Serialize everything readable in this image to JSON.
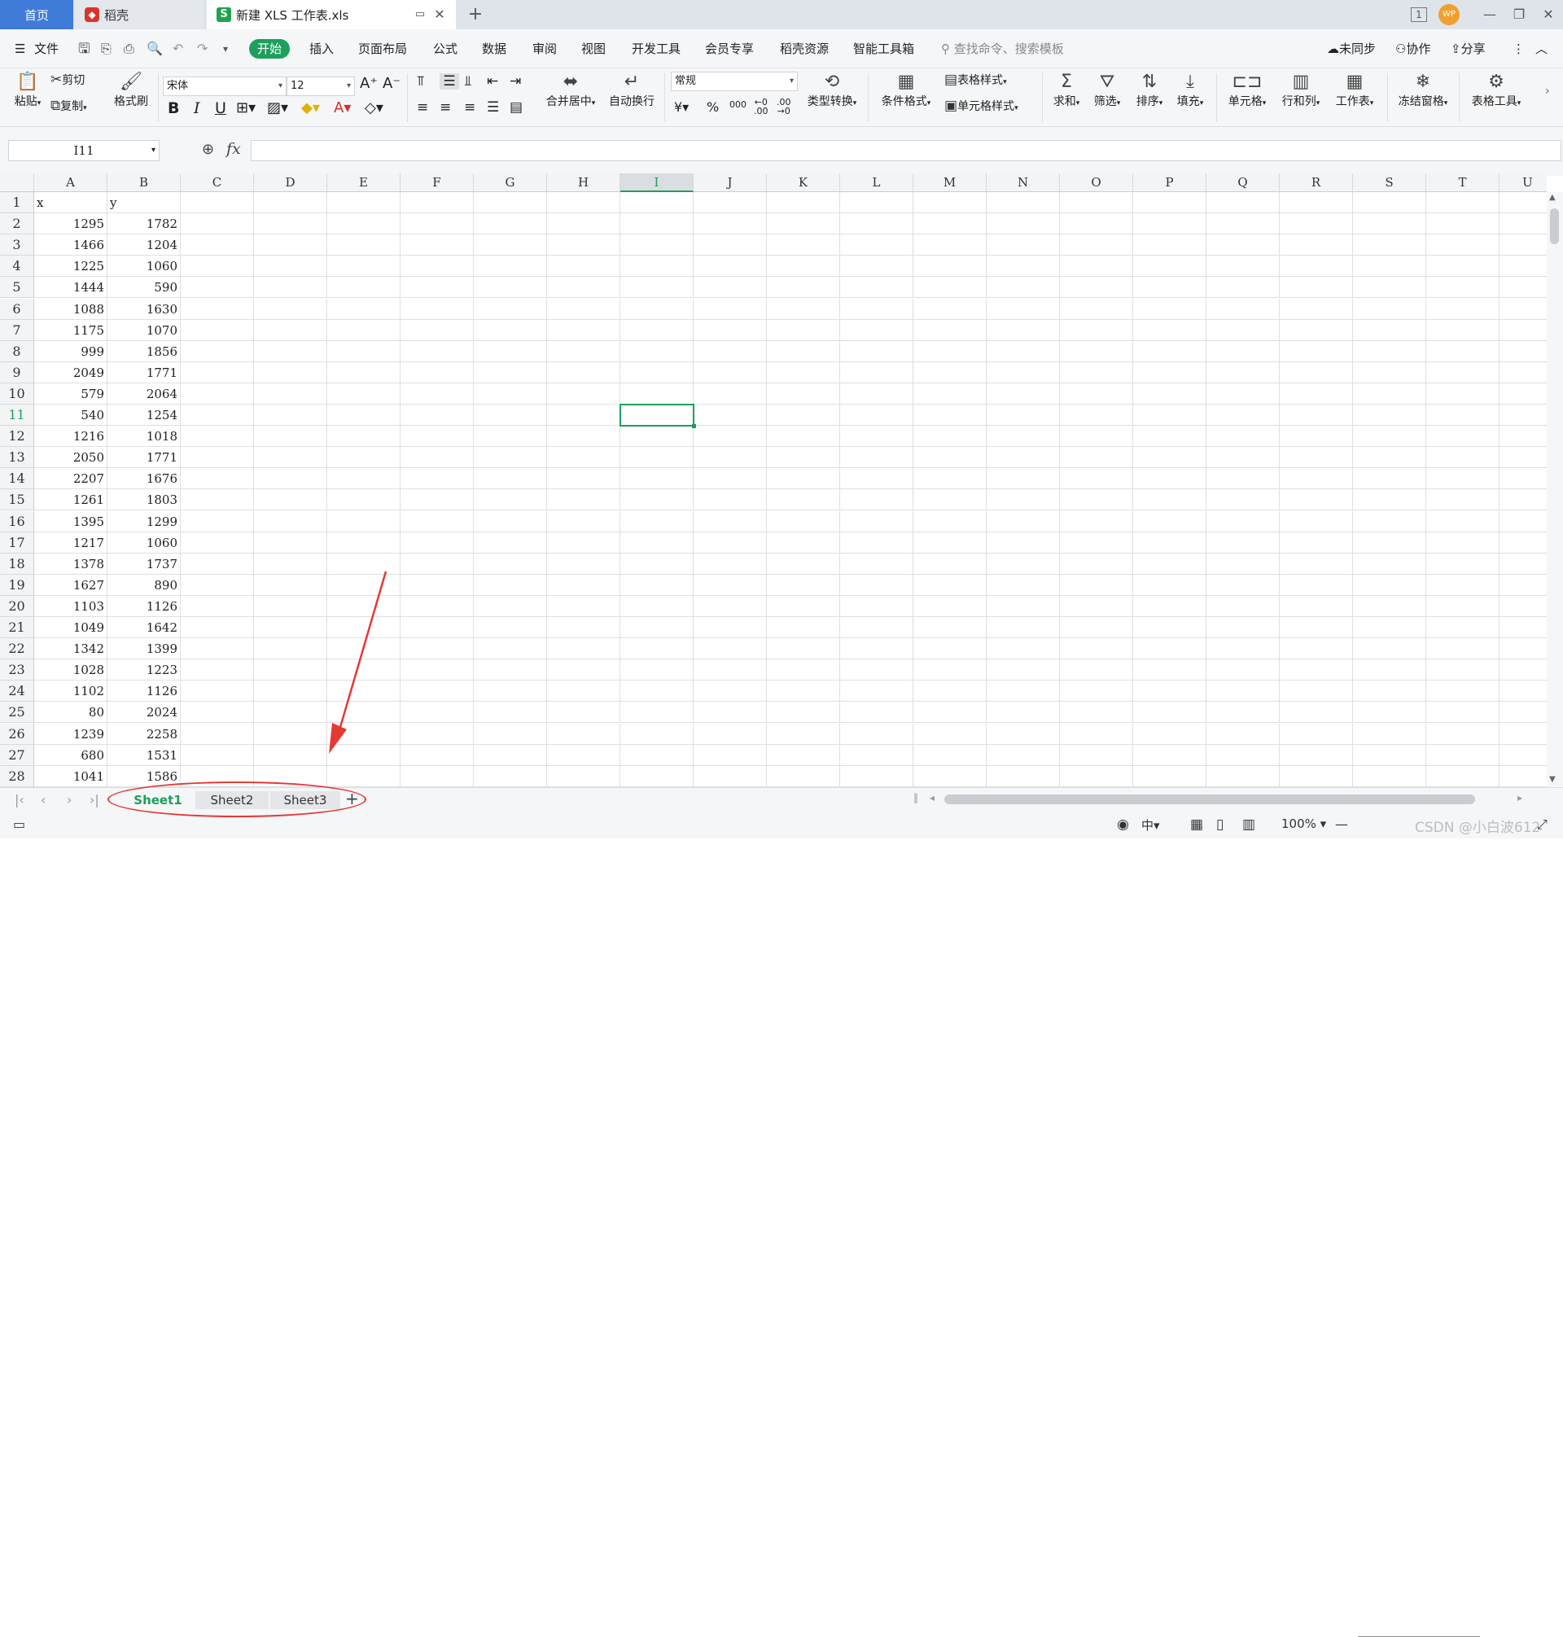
{
  "window": {
    "tab_home": "首页",
    "tab_daoke": "稻壳",
    "tab_file": "新建 XLS 工作表.xls",
    "new_tab": "+",
    "avatar_text": "WP",
    "page_indicator": "1"
  },
  "menu": {
    "file": "文件",
    "items": [
      "开始",
      "插入",
      "页面布局",
      "公式",
      "数据",
      "审阅",
      "视图",
      "开发工具",
      "会员专享",
      "稻壳资源",
      "智能工具箱"
    ],
    "search_placeholder": "查找命令、搜索模板",
    "unsynced": "未同步",
    "collab": "协作",
    "share": "分享"
  },
  "ribbon": {
    "paste": "粘贴",
    "cut": "剪切",
    "copy": "复制",
    "format_painter": "格式刷",
    "font_name": "宋体",
    "font_size": "12",
    "merge_center": "合并居中",
    "wrap": "自动换行",
    "number_format": "常规",
    "type_convert": "类型转换",
    "cond_format": "条件格式",
    "table_style": "表格样式",
    "cell_style": "单元格样式",
    "sum": "求和",
    "filter": "筛选",
    "sort": "排序",
    "fill": "填充",
    "cell": "单元格",
    "row_col": "行和列",
    "worksheet": "工作表",
    "freeze": "冻结窗格",
    "table_tools": "表格工具"
  },
  "formula_bar": {
    "name_box": "I11",
    "fx": "fx",
    "formula": ""
  },
  "grid": {
    "columns": [
      "A",
      "B",
      "C",
      "D",
      "E",
      "F",
      "G",
      "H",
      "I",
      "J",
      "K",
      "L",
      "M",
      "N",
      "O",
      "P",
      "Q",
      "R",
      "S",
      "T",
      "U"
    ],
    "selected_column": "I",
    "selected_row": 11,
    "rows": [
      [
        "x",
        "y"
      ],
      [
        "1295",
        "1782"
      ],
      [
        "1466",
        "1204"
      ],
      [
        "1225",
        "1060"
      ],
      [
        "1444",
        "590"
      ],
      [
        "1088",
        "1630"
      ],
      [
        "1175",
        "1070"
      ],
      [
        "999",
        "1856"
      ],
      [
        "2049",
        "1771"
      ],
      [
        "579",
        "2064"
      ],
      [
        "540",
        "1254"
      ],
      [
        "1216",
        "1018"
      ],
      [
        "2050",
        "1771"
      ],
      [
        "2207",
        "1676"
      ],
      [
        "1261",
        "1803"
      ],
      [
        "1395",
        "1299"
      ],
      [
        "1217",
        "1060"
      ],
      [
        "1378",
        "1737"
      ],
      [
        "1627",
        "890"
      ],
      [
        "1103",
        "1126"
      ],
      [
        "1049",
        "1642"
      ],
      [
        "1342",
        "1399"
      ],
      [
        "1028",
        "1223"
      ],
      [
        "1102",
        "1126"
      ],
      [
        "80",
        "2024"
      ],
      [
        "1239",
        "2258"
      ],
      [
        "680",
        "1531"
      ],
      [
        "1041",
        "1586"
      ]
    ]
  },
  "sheets": [
    "Sheet1",
    "Sheet2",
    "Sheet3"
  ],
  "status": {
    "zoom": "100%",
    "watermark": "CSDN @小白波612"
  },
  "colors": {
    "accent": "#1e9f5c",
    "home_tab": "#3f7bd8",
    "annotation": "#e53935"
  }
}
